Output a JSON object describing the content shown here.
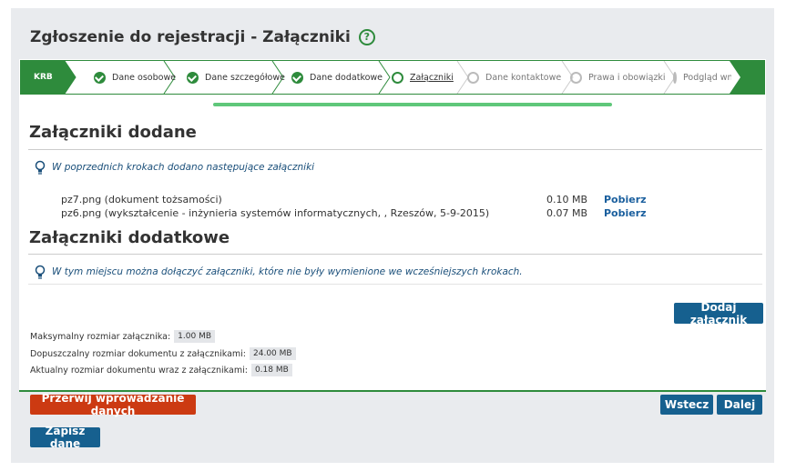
{
  "page": {
    "title": "Zgłoszenie do rejestracji - Załączniki"
  },
  "stepper": {
    "krb": "KRB",
    "steps": [
      {
        "label": "Dane osobowe",
        "state": "done"
      },
      {
        "label": "Dane szczegółowe",
        "state": "done"
      },
      {
        "label": "Dane dodatkowe",
        "state": "done"
      },
      {
        "label": "Załączniki",
        "state": "current"
      },
      {
        "label": "Dane kontaktowe",
        "state": "todo"
      },
      {
        "label": "Prawa i obowiązki",
        "state": "todo"
      },
      {
        "label": "Podgląd wniosku",
        "state": "todo"
      }
    ]
  },
  "added": {
    "heading": "Załączniki dodane",
    "info": "W poprzednich krokach dodano następujące załączniki",
    "files": [
      {
        "name": "pz7.png (dokument tożsamości)",
        "size": "0.10 MB",
        "action": "Pobierz"
      },
      {
        "name": "pz6.png (wykształcenie - inżynieria systemów informatycznych, , Rzeszów, 5-9-2015)",
        "size": "0.07 MB",
        "action": "Pobierz"
      }
    ]
  },
  "additional": {
    "heading": "Załączniki dodatkowe",
    "info": "W tym miejscu można dołączyć załączniki, które nie były wymienione we wcześniejszych krokach.",
    "add_button": "Dodaj załącznik"
  },
  "limits": [
    {
      "label": "Maksymalny rozmiar załącznika:",
      "value": "1.00 MB"
    },
    {
      "label": "Dopuszczalny rozmiar dokumentu z załącznikami:",
      "value": "24.00 MB"
    },
    {
      "label": "Aktualny rozmiar dokumentu wraz z załącznikami:",
      "value": "0.18 MB"
    }
  ],
  "actions": {
    "abort": "Przerwij wprowadzanie danych",
    "back": "Wstecz",
    "next": "Dalej",
    "save": "Zapisz dane"
  },
  "colors": {
    "accent": "#2e8b3c",
    "primary_button": "#16608f",
    "danger_button": "#cc3a12"
  }
}
